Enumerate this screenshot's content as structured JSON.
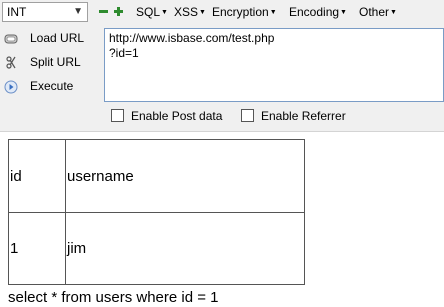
{
  "toolbar": {
    "type_select": {
      "value": "INT"
    },
    "menus": [
      {
        "label": "SQL"
      },
      {
        "label": "XSS"
      },
      {
        "label": "Encryption"
      },
      {
        "label": "Encoding"
      },
      {
        "label": "Other"
      }
    ],
    "colors": {
      "minus_icon": "#2e8b2e",
      "plus_icon": "#2e8b2e"
    }
  },
  "sidebar": {
    "actions": [
      {
        "label": "Load URL",
        "icon": "load-url-icon"
      },
      {
        "label": "Split URL",
        "icon": "split-url-icon"
      },
      {
        "label": "Execute",
        "icon": "execute-icon"
      }
    ]
  },
  "url_input": {
    "value": "http://www.isbase.com/test.php\n?id=1"
  },
  "options": {
    "post_data": {
      "label": "Enable Post data",
      "checked": false
    },
    "referrer": {
      "label": "Enable Referrer",
      "checked": false
    }
  },
  "results": {
    "headers": [
      "id",
      "username"
    ],
    "rows": [
      [
        "1",
        "jim"
      ]
    ]
  },
  "query": {
    "text": "select * from users where id = 1"
  }
}
